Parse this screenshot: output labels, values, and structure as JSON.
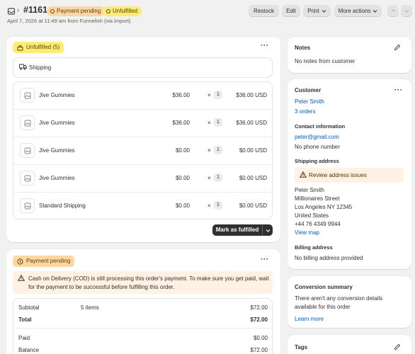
{
  "header": {
    "order_number": "#1161",
    "badges": {
      "payment": "Payment pending",
      "fulfillment": "Unfulfilled"
    },
    "subline": "April 7, 2026 at 11:49 am from Funnelish (via import)",
    "buttons": {
      "restock": "Restock",
      "edit": "Edit",
      "print": "Print",
      "more": "More actions"
    }
  },
  "fulfillment_card": {
    "status": "Unfulfilled (5)",
    "shipping_label": "Shipping",
    "items": [
      {
        "name": "Jive Gummies",
        "price": "$36.00",
        "times": "×",
        "qty": "1",
        "total": "$36.00 USD"
      },
      {
        "name": "Jive Gummies",
        "price": "$36.00",
        "times": "×",
        "qty": "1",
        "total": "$36.00 USD"
      },
      {
        "name": "Jive Gummies",
        "price": "$0.00",
        "times": "×",
        "qty": "1",
        "total": "$0.00 USD"
      },
      {
        "name": "Jive Gummies",
        "price": "$0.00",
        "times": "×",
        "qty": "1",
        "total": "$0.00 USD"
      },
      {
        "name": "Standard Shipping",
        "price": "$0.00",
        "times": "×",
        "qty": "1",
        "total": "$0.00 USD"
      }
    ],
    "mark_button": "Mark as fulfilled"
  },
  "payment_card": {
    "status": "Payment pending",
    "notice": "Cash on Delivery (COD) is still processing this order's payment. To make sure you get paid, wait for the payment to be successful before fulfilling this order.",
    "summary": {
      "subtotal_label": "Subtotal",
      "subtotal_items": "5 items",
      "subtotal_value": "$72.00",
      "total_label": "Total",
      "total_value": "$72.00",
      "paid_label": "Paid",
      "paid_value": "$0.00",
      "balance_label": "Balance",
      "balance_value": "$72.00"
    }
  },
  "notes": {
    "title": "Notes",
    "text": "No notes from customer"
  },
  "customer": {
    "title": "Customer",
    "name": "Peter Smith",
    "orders": "3 orders",
    "contact_title": "Contact information",
    "email": "peter@gmail.com",
    "phone": "No phone number",
    "shipping_title": "Shipping address",
    "review": "Review address issues",
    "address": [
      "Peter Smith",
      "Millionaires Street",
      "Los Angeles NY 12345",
      "United States",
      "+44 76 4349 9944"
    ],
    "view_map": "View map",
    "billing_title": "Billing address",
    "billing_text": "No billing address provided"
  },
  "conversion": {
    "title": "Conversion summary",
    "text_line1": "There aren't any conversion details",
    "text_line2": "available for this order",
    "learn_more": "Learn more"
  },
  "tags": {
    "title": "Tags"
  },
  "colors": {
    "accent_link": "#005bd3",
    "badge_orange": "#ffd6a4",
    "badge_yellow": "#ffeb78",
    "primary_button": "#303030"
  }
}
